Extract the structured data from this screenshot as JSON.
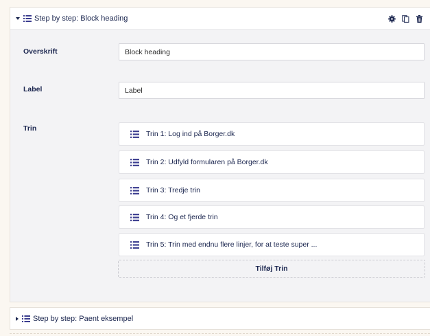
{
  "block1": {
    "title": "Step by step: Block heading",
    "actions": [
      "settings-icon",
      "copy-icon",
      "delete-icon"
    ],
    "fields": {
      "overskrift": {
        "label": "Overskrift",
        "value": "Block heading"
      },
      "label": {
        "label": "Label",
        "value": "Label"
      },
      "trin": {
        "label": "Trin"
      }
    },
    "steps": [
      {
        "label": "Trin 1: Log ind på Borger.dk"
      },
      {
        "label": "Trin 2: Udfyld formularen på Borger.dk"
      },
      {
        "label": "Trin 3: Tredje trin"
      },
      {
        "label": "Trin 4: Og et fjerde trin"
      },
      {
        "label": "Trin 5: Trin med endnu flere linjer, for at teste super ..."
      }
    ],
    "add_step_label": "Tilføj Trin"
  },
  "block2": {
    "title": "Step by step: Paent eksempel"
  },
  "colors": {
    "text": "#1b264f",
    "accent_icon": "#3b3d8f",
    "page_background": "#fbf7f1",
    "panel_background": "#f3f3f5"
  }
}
